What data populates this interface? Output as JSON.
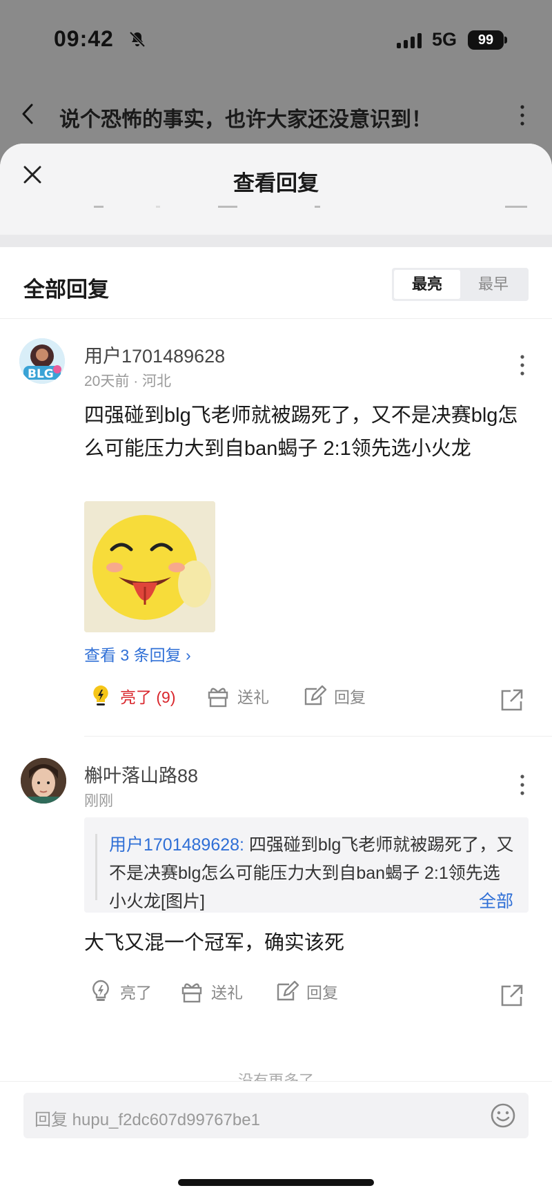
{
  "status_bar": {
    "time": "09:42",
    "network": "5G",
    "battery": "99"
  },
  "background_page": {
    "title": "说个恐怖的事实，也许大家还没意识到！"
  },
  "sheet": {
    "title": "查看回复",
    "section_title": "全部回复",
    "sort_options": [
      "最亮",
      "最早"
    ],
    "sort_selected": "最亮"
  },
  "replies": [
    {
      "username": "用户1701489628",
      "meta": "20天前 · 河北",
      "content": "四强碰到blg飞老师就被踢死了，又不是决赛blg怎么可能压力大到自ban蝎子 2:1领先选小火龙",
      "view_replies": "查看 3 条回复",
      "like_label": "亮了 (9)",
      "gift_label": "送礼",
      "reply_label": "回复"
    },
    {
      "username": "槲叶落山路88",
      "meta": "刚刚",
      "quote_user": "用户1701489628:",
      "quote_text": " 四强碰到blg飞老师就被踢死了，又不是决赛blg怎么可能压力大到自ban蝎子 2:1领先选小火龙[图片]",
      "quote_all": "全部",
      "content": "大飞又混一个冠军，确实该死",
      "like_label": "亮了",
      "gift_label": "送礼",
      "reply_label": "回复"
    }
  ],
  "no_more": "没有更多了",
  "input": {
    "placeholder": "回复 hupu_f2dc607d99767be1"
  },
  "colors": {
    "accent_blue": "#2f6fd6",
    "like_red": "#d9262c",
    "overlay": "#8a8a8a"
  }
}
